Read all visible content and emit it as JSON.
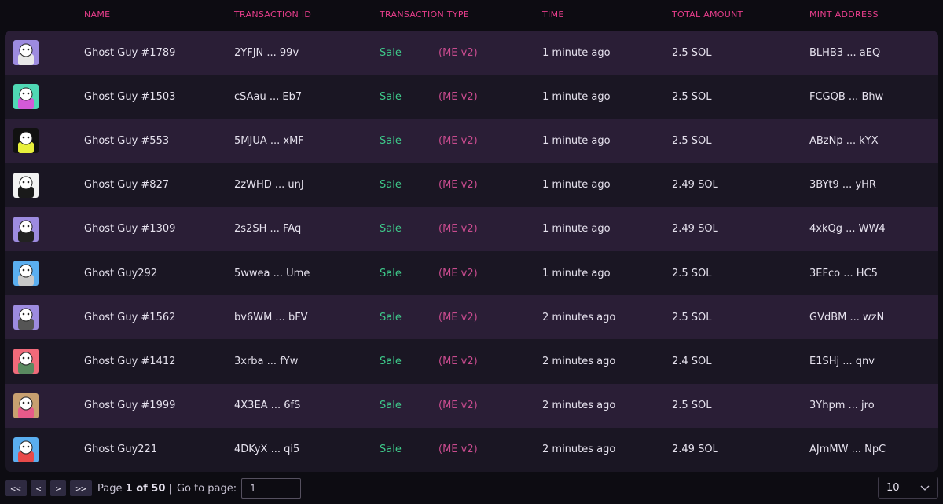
{
  "columns": {
    "name": "NAME",
    "tx_id": "TRANSACTION ID",
    "tx_type": "TRANSACTION TYPE",
    "time": "TIME",
    "amount": "TOTAL AMOUNT",
    "mint": "MINT ADDRESS"
  },
  "rows": [
    {
      "name": "Ghost Guy #1789",
      "tx_id": "2YFJN ... 99v",
      "type": "Sale",
      "market": "(ME v2)",
      "time": "1 minute ago",
      "amount": "2.5 SOL",
      "mint": "BLHB3 ... aEQ",
      "avatar_bg": "#9d8be0",
      "avatar_item": "#e8e8e8"
    },
    {
      "name": "Ghost Guy #1503",
      "tx_id": "cSAau ... Eb7",
      "type": "Sale",
      "market": "(ME v2)",
      "time": "1 minute ago",
      "amount": "2.5 SOL",
      "mint": "FCGQB ... Bhw",
      "avatar_bg": "#4fd8b4",
      "avatar_item": "#d45ad8"
    },
    {
      "name": "Ghost Guy #553",
      "tx_id": "5MJUA ... xMF",
      "type": "Sale",
      "market": "(ME v2)",
      "time": "1 minute ago",
      "amount": "2.5 SOL",
      "mint": "ABzNp ... kYX",
      "avatar_bg": "#111111",
      "avatar_item": "#e8f03c"
    },
    {
      "name": "Ghost Guy #827",
      "tx_id": "2zWHD ... unJ",
      "type": "Sale",
      "market": "(ME v2)",
      "time": "1 minute ago",
      "amount": "2.49 SOL",
      "mint": "3BYt9 ... yHR",
      "avatar_bg": "#f2f2f2",
      "avatar_item": "#1a1a1a"
    },
    {
      "name": "Ghost Guy #1309",
      "tx_id": "2s2SH ... FAq",
      "type": "Sale",
      "market": "(ME v2)",
      "time": "1 minute ago",
      "amount": "2.49 SOL",
      "mint": "4xkQg ... WW4",
      "avatar_bg": "#9d8be0",
      "avatar_item": "#222222"
    },
    {
      "name": "Ghost Guy292",
      "tx_id": "5wwea ... Ume",
      "type": "Sale",
      "market": "(ME v2)",
      "time": "1 minute ago",
      "amount": "2.5 SOL",
      "mint": "3EFco ... HC5",
      "avatar_bg": "#5aaef0",
      "avatar_item": "#c8c8c8"
    },
    {
      "name": "Ghost Guy #1562",
      "tx_id": "bv6WM ... bFV",
      "type": "Sale",
      "market": "(ME v2)",
      "time": "2 minutes ago",
      "amount": "2.5 SOL",
      "mint": "GVdBM ... wzN",
      "avatar_bg": "#9d8be0",
      "avatar_item": "#555555"
    },
    {
      "name": "Ghost Guy #1412",
      "tx_id": "3xrba ... fYw",
      "type": "Sale",
      "market": "(ME v2)",
      "time": "2 minutes ago",
      "amount": "2.4 SOL",
      "mint": "E1SHj ... qnv",
      "avatar_bg": "#f06a7a",
      "avatar_item": "#5a8a60"
    },
    {
      "name": "Ghost Guy #1999",
      "tx_id": "4X3EA ... 6fS",
      "type": "Sale",
      "market": "(ME v2)",
      "time": "2 minutes ago",
      "amount": "2.5 SOL",
      "mint": "3Yhpm ... jro",
      "avatar_bg": "#c8a070",
      "avatar_item": "#e85a8a"
    },
    {
      "name": "Ghost Guy221",
      "tx_id": "4DKyX ... qi5",
      "type": "Sale",
      "market": "(ME v2)",
      "time": "2 minutes ago",
      "amount": "2.49 SOL",
      "mint": "AJmMW ... NpC",
      "avatar_bg": "#5aaef0",
      "avatar_item": "#e84a4a"
    }
  ],
  "pagination": {
    "first_label": "<<",
    "prev_label": "<",
    "next_label": ">",
    "last_label": ">>",
    "page_word": "Page",
    "page_of": "1 of 50",
    "separator": "|",
    "goto_label": "Go to page:",
    "goto_value": "1",
    "page_size": "10"
  },
  "colors": {
    "header_text": "#e83e8c",
    "sale": "#3ec98a",
    "market": "#c84b8e",
    "row_odd": "#2a1e36",
    "row_even": "#1a1623"
  },
  "icons": {
    "avatar": "ghost-avatar-icon",
    "dropdown": "chevron-down-icon"
  }
}
